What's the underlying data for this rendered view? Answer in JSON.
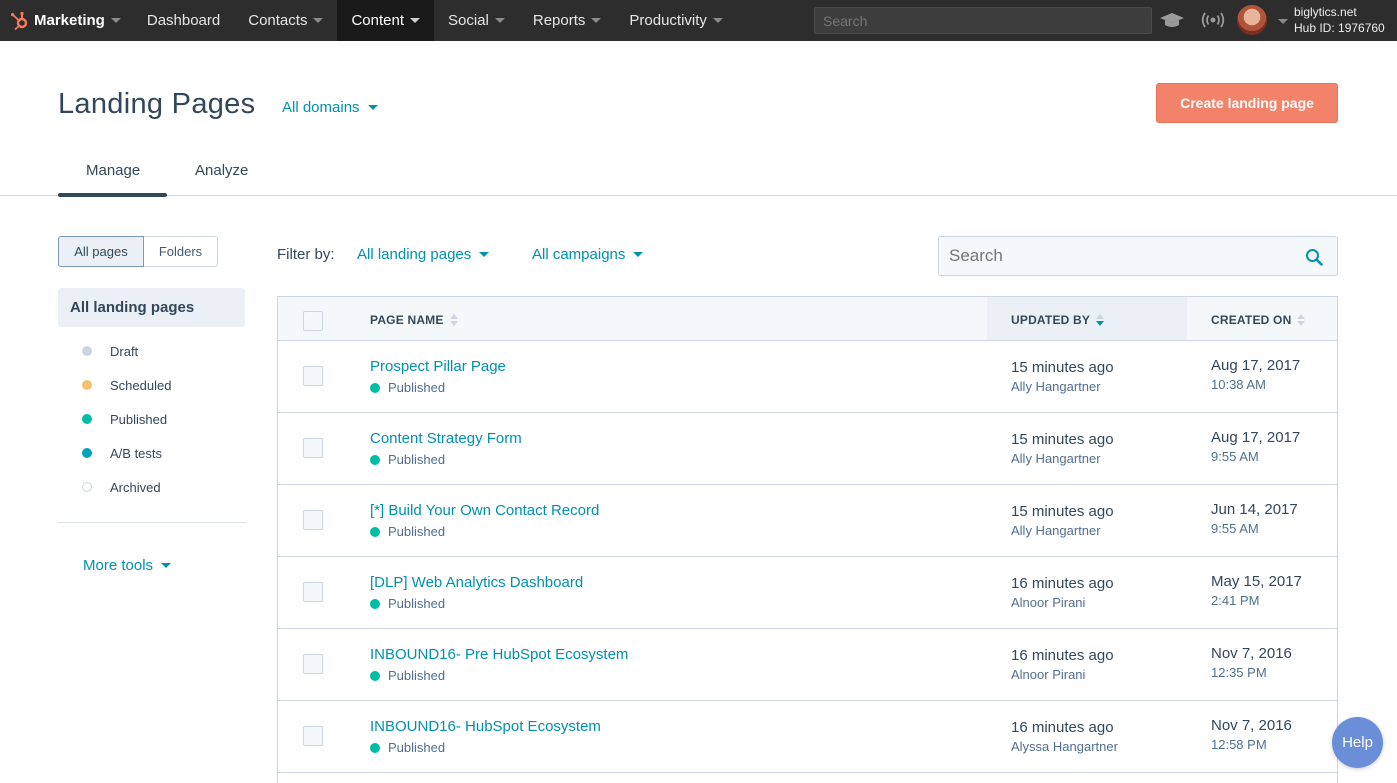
{
  "nav": {
    "brand": "Marketing",
    "items": [
      {
        "label": "Dashboard",
        "caret": false,
        "active": false
      },
      {
        "label": "Contacts",
        "caret": true,
        "active": false
      },
      {
        "label": "Content",
        "caret": true,
        "active": true
      },
      {
        "label": "Social",
        "caret": true,
        "active": false
      },
      {
        "label": "Reports",
        "caret": true,
        "active": false
      },
      {
        "label": "Productivity",
        "caret": true,
        "active": false
      }
    ],
    "search_placeholder": "Search",
    "account_name": "biglytics.net",
    "hub_id": "Hub ID: 1976760"
  },
  "header": {
    "title": "Landing Pages",
    "domains": "All domains",
    "create_button": "Create landing page"
  },
  "tabs": {
    "manage": "Manage",
    "analyze": "Analyze"
  },
  "sidebar": {
    "toggle_all": "All pages",
    "toggle_folders": "Folders",
    "all_label": "All landing pages",
    "items": [
      {
        "label": "Draft",
        "color": "#cbd6e2"
      },
      {
        "label": "Scheduled",
        "color": "#f5c26b"
      },
      {
        "label": "Published",
        "color": "#00bda5"
      },
      {
        "label": "A/B tests",
        "color": "#00a4bd"
      },
      {
        "label": "Archived",
        "color": "#ffffff"
      }
    ],
    "more_tools": "More tools"
  },
  "filters": {
    "label": "Filter by:",
    "pages": "All landing pages",
    "campaigns": "All campaigns",
    "search_placeholder": "Search"
  },
  "table": {
    "columns": {
      "name": "PAGE NAME",
      "updated": "UPDATED BY",
      "created": "CREATED ON"
    },
    "rows": [
      {
        "name": "Prospect Pillar Page",
        "status": "Published",
        "updated": "15 minutes ago",
        "updated_by": "Ally Hangartner",
        "created": "Aug 17, 2017",
        "created_time": "10:38 AM"
      },
      {
        "name": "Content Strategy Form",
        "status": "Published",
        "updated": "15 minutes ago",
        "updated_by": "Ally Hangartner",
        "created": "Aug 17, 2017",
        "created_time": "9:55 AM"
      },
      {
        "name": "[*] Build Your Own Contact Record",
        "status": "Published",
        "updated": "15 minutes ago",
        "updated_by": "Ally Hangartner",
        "created": "Jun 14, 2017",
        "created_time": "9:55 AM"
      },
      {
        "name": "[DLP] Web Analytics Dashboard",
        "status": "Published",
        "updated": "16 minutes ago",
        "updated_by": "Alnoor Pirani",
        "created": "May 15, 2017",
        "created_time": "2:41 PM"
      },
      {
        "name": "INBOUND16- Pre HubSpot Ecosystem",
        "status": "Published",
        "updated": "16 minutes ago",
        "updated_by": "Alnoor Pirani",
        "created": "Nov 7, 2016",
        "created_time": "12:35 PM"
      },
      {
        "name": "INBOUND16- HubSpot Ecosystem",
        "status": "Published",
        "updated": "16 minutes ago",
        "updated_by": "Alyssa Hangartner",
        "created": "Nov 7, 2016",
        "created_time": "12:58 PM"
      }
    ]
  },
  "help": "Help",
  "colors": {
    "accent": "#0091ae",
    "cta": "#f2826a",
    "published": "#00bda5",
    "nav_bg": "#2d2d2d"
  }
}
